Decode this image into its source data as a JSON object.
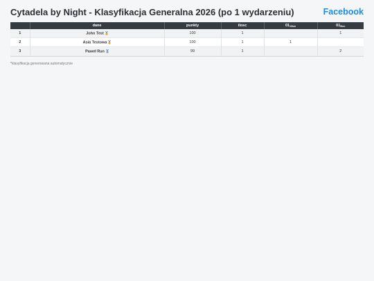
{
  "header": {
    "title": "Cytadela by Night - Klasyfikacja Generalna 2026 (po 1 wydarzeniu)",
    "facebook_label": "Facebook"
  },
  "table": {
    "columns": {
      "place": "",
      "name": "dane",
      "points": "punkty",
      "count": "ilosc",
      "event1": "01",
      "event1_sub": "10km",
      "event2": "01",
      "event2_sub": "5km"
    },
    "rows": [
      {
        "place": "1",
        "name": "John Test",
        "medal": "gold-medal-icon",
        "points": "100",
        "count": "1",
        "event1": "",
        "event2": "1"
      },
      {
        "place": "2",
        "name": "Asia Testowa",
        "medal": "gold-medal-icon",
        "points": "100",
        "count": "1",
        "event1": "1",
        "event2": ""
      },
      {
        "place": "3",
        "name": "Paweł Run",
        "medal": "silver-medal-icon",
        "points": "99",
        "count": "1",
        "event1": "",
        "event2": "2"
      }
    ]
  },
  "footnote": "*klasyfikacja generowana automatycznie",
  "colors": {
    "header_bg": "#353b40",
    "link": "#1a8fe0",
    "gold": "#e3a91b",
    "silver": "#9aa3ab"
  }
}
